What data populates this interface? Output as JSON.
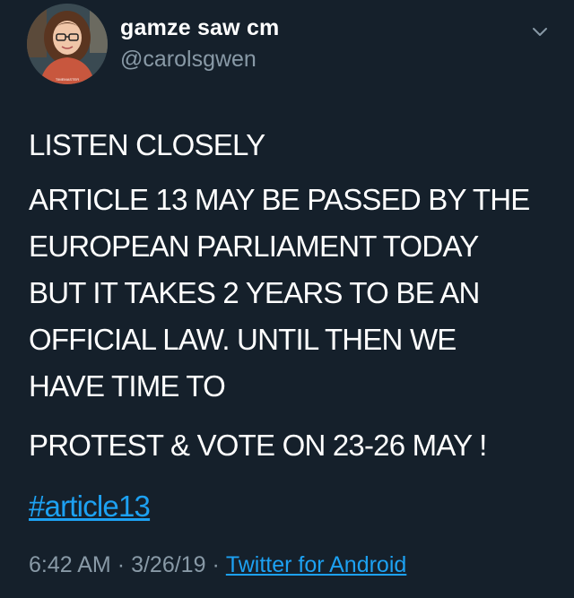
{
  "tweet": {
    "author": {
      "display_name": "gamze saw cm",
      "handle": "@carolsgwen",
      "avatar_shirt_text": "TIMEMASTER"
    },
    "menu_icon": "chevron-down-icon",
    "paragraphs": [
      "LISTEN CLOSELY",
      "ARTICLE 13 MAY BE PASSED BY THE\nEUROPEAN PARLIAMENT TODAY\nBUT IT TAKES 2 YEARS TO BE AN\nOFFICIAL LAW. UNTIL THEN WE\nHAVE TIME TO",
      "PROTEST & VOTE ON 23-26 MAY !"
    ],
    "hashtag": "#article13",
    "time": "6:42 AM",
    "date": "3/26/19",
    "separator": "·",
    "source": "Twitter for Android"
  },
  "colors": {
    "background": "#15202b",
    "text": "#ffffff",
    "secondary_text": "#8899a6",
    "link": "#1da1f2"
  }
}
